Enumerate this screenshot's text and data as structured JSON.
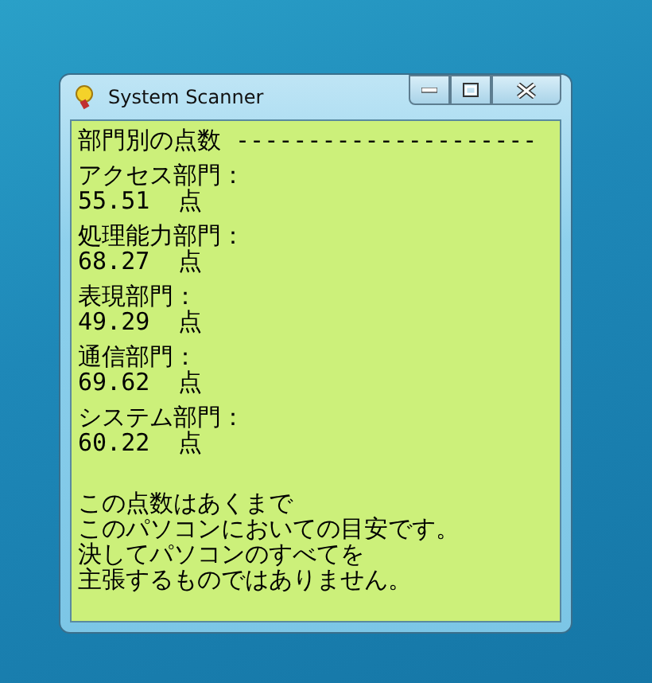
{
  "window": {
    "title": "System Scanner"
  },
  "heading": "部門別の点数 ---------------------",
  "departments": [
    {
      "name": "アクセス部門：",
      "score": "55.51  点"
    },
    {
      "name": "処理能力部門：",
      "score": "68.27  点"
    },
    {
      "name": "表現部門：",
      "score": "49.29  点"
    },
    {
      "name": "通信部門：",
      "score": "69.62  点"
    },
    {
      "name": "システム部門：",
      "score": "60.22  点"
    }
  ],
  "note": [
    "この点数はあくまで",
    "このパソコンにおいての目安です。",
    "決してパソコンのすべてを",
    "主張するものではありません。"
  ]
}
